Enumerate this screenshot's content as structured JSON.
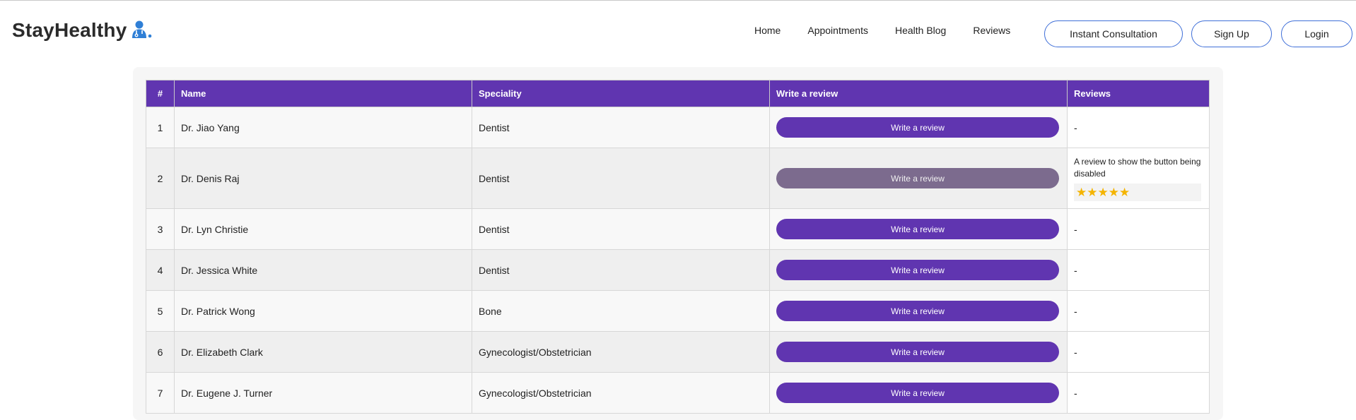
{
  "brand": {
    "name": "StayHealthy",
    "icon": "doctor-icon"
  },
  "nav": {
    "links": [
      "Home",
      "Appointments",
      "Health Blog",
      "Reviews"
    ],
    "instant_consultation": "Instant Consultation",
    "sign_up": "Sign Up",
    "login": "Login"
  },
  "colors": {
    "accent": "#6035b0",
    "button_border": "#3f6fd8",
    "disabled": "#7c6b8e",
    "star": "#f4b400"
  },
  "table": {
    "headers": [
      "#",
      "Name",
      "Speciality",
      "Write a review",
      "Reviews"
    ],
    "rows": [
      {
        "num": "1",
        "name": "Dr. Jiao Yang",
        "speciality": "Dentist",
        "button": "Write a review",
        "disabled": false,
        "review": "-"
      },
      {
        "num": "2",
        "name": "Dr. Denis Raj",
        "speciality": "Dentist",
        "button": "Write a review",
        "disabled": true,
        "review": "A review to show the button being disabled",
        "stars": 5
      },
      {
        "num": "3",
        "name": "Dr. Lyn Christie",
        "speciality": "Dentist",
        "button": "Write a review",
        "disabled": false,
        "review": "-"
      },
      {
        "num": "4",
        "name": "Dr. Jessica White",
        "speciality": "Dentist",
        "button": "Write a review",
        "disabled": false,
        "review": "-"
      },
      {
        "num": "5",
        "name": "Dr. Patrick Wong",
        "speciality": "Bone",
        "button": "Write a review",
        "disabled": false,
        "review": "-"
      },
      {
        "num": "6",
        "name": "Dr. Elizabeth Clark",
        "speciality": "Gynecologist/Obstetrician",
        "button": "Write a review",
        "disabled": false,
        "review": "-"
      },
      {
        "num": "7",
        "name": "Dr. Eugene J. Turner",
        "speciality": "Gynecologist/Obstetrician",
        "button": "Write a review",
        "disabled": false,
        "review": "-"
      }
    ]
  }
}
